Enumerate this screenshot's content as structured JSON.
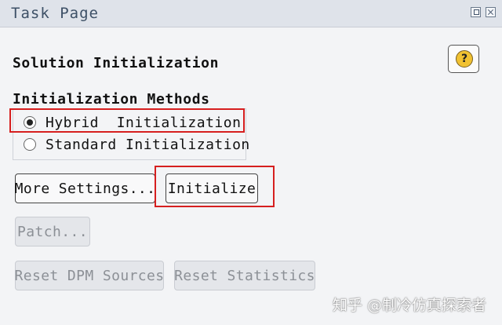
{
  "window": {
    "title": "Task Page"
  },
  "section": {
    "title": "Solution Initialization",
    "help_symbol": "?"
  },
  "methods": {
    "label": "Initialization Methods",
    "options": [
      {
        "label": "Hybrid  Initialization",
        "selected": true
      },
      {
        "label": "Standard Initialization",
        "selected": false
      }
    ]
  },
  "buttons": {
    "more_settings": "More Settings...",
    "initialize": "Initialize",
    "patch": "Patch...",
    "reset_dpm": "Reset DPM Sources",
    "reset_statistics": "Reset Statistics"
  },
  "watermark": {
    "text": "知乎 @制冷仿真探索者"
  },
  "colors": {
    "highlight": "#d61f1f",
    "help_icon": "#f1c232"
  }
}
